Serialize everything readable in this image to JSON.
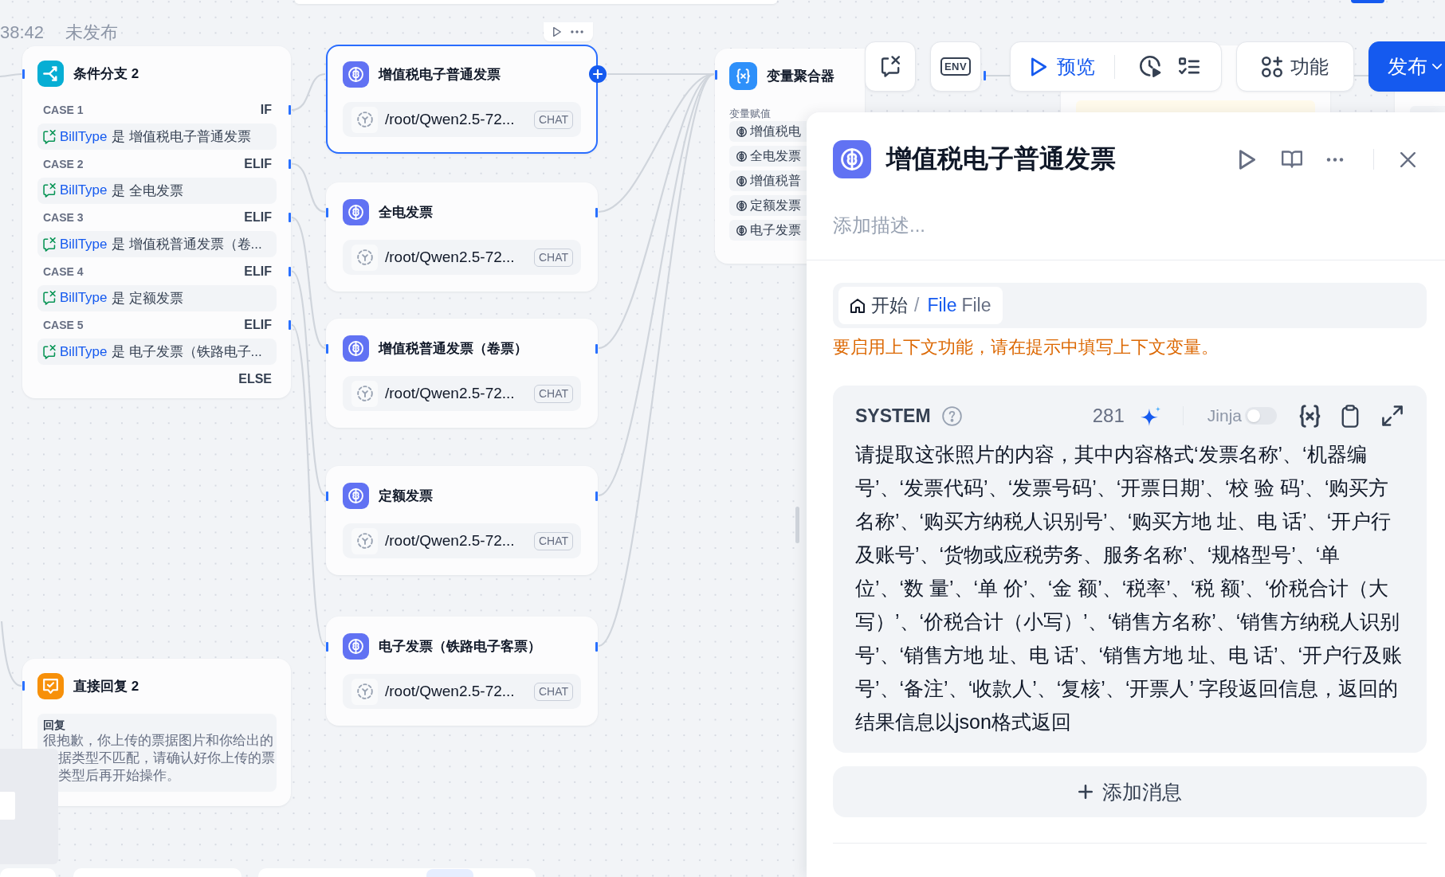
{
  "canvas_header": {
    "time": "38:42",
    "status": "未发布"
  },
  "condition_node": {
    "title": "条件分支 2",
    "cases": [
      {
        "label": "CASE 1",
        "branch": "IF",
        "variable": "BillType",
        "operator": "是",
        "value": "增值税电子普通发票"
      },
      {
        "label": "CASE 2",
        "branch": "ELIF",
        "variable": "BillType",
        "operator": "是",
        "value": "全电发票"
      },
      {
        "label": "CASE 3",
        "branch": "ELIF",
        "variable": "BillType",
        "operator": "是",
        "value": "增值税普通发票（卷..."
      },
      {
        "label": "CASE 4",
        "branch": "ELIF",
        "variable": "BillType",
        "operator": "是",
        "value": "定额发票"
      },
      {
        "label": "CASE 5",
        "branch": "ELIF",
        "variable": "BillType",
        "operator": "是",
        "value": "电子发票（铁路电子..."
      }
    ],
    "else_label": "ELSE"
  },
  "reply_node": {
    "title": "直接回复 2",
    "label": "回复",
    "text_lines": [
      "很抱歉，你上传的票据图片和你给出的",
      "据类型不匹配，请确认好你上传的票",
      "类型后再开始操作。"
    ]
  },
  "llm_nodes": [
    {
      "title": "增值税电子普通发票",
      "model": "/root/Qwen2.5-72...",
      "mode": "CHAT",
      "selected": true
    },
    {
      "title": "全电发票",
      "model": "/root/Qwen2.5-72...",
      "mode": "CHAT",
      "selected": false
    },
    {
      "title": "增值税普通发票（卷票）",
      "model": "/root/Qwen2.5-72...",
      "mode": "CHAT",
      "selected": false
    },
    {
      "title": "定额发票",
      "model": "/root/Qwen2.5-72...",
      "mode": "CHAT",
      "selected": false
    },
    {
      "title": "电子发票（铁路电子客票）",
      "model": "/root/Qwen2.5-72...",
      "mode": "CHAT",
      "selected": false
    }
  ],
  "aggregator_node": {
    "title": "变量聚合器",
    "section": "变量赋值",
    "items": [
      "增值税电",
      "全电发票",
      "增值税普",
      "定额发票",
      "电子发票"
    ]
  },
  "toolbar": {
    "env": "ENV",
    "preview": "预览",
    "features": "功能",
    "publish": "发布"
  },
  "panel": {
    "title": "增值税电子普通发票",
    "description_placeholder": "添加描述...",
    "context": {
      "node": "开始",
      "separator": "/",
      "variable": "File",
      "type": "File"
    },
    "context_warning": "要启用上下文功能，请在提示中填写上下文变量。",
    "messages": [
      {
        "role": "SYSTEM",
        "token_count": "281",
        "jinja_label": "Jinja",
        "jinja_enabled": false,
        "text": "请提取这张照片的内容，其中内容格式‘发票名称’、‘机器编号’、‘发票代码’、‘发票号码’、‘开票日期’、‘校 验 码’、‘购买方名称’、‘购买方纳税人识别号’、‘购买方地 址、电 话’、‘开户行及账号’、‘货物或应税劳务、服务名称’、‘规格型号’、‘单位’、‘数 量’、‘单 价’、‘金 额’、‘税率’、‘税 额’、‘价税合计（大写）’、‘价税合计（小写）’、‘销售方名称’、‘销售方纳税人识别号’、‘销售方地 址、电 话’、‘销售方地 址、电 话’、‘开户行及账号’、‘备注’、‘收款人’、‘复核’、‘开票人’ 字段返回信息，返回的结果信息以json格式返回"
      }
    ],
    "add_message": "添加消息"
  }
}
